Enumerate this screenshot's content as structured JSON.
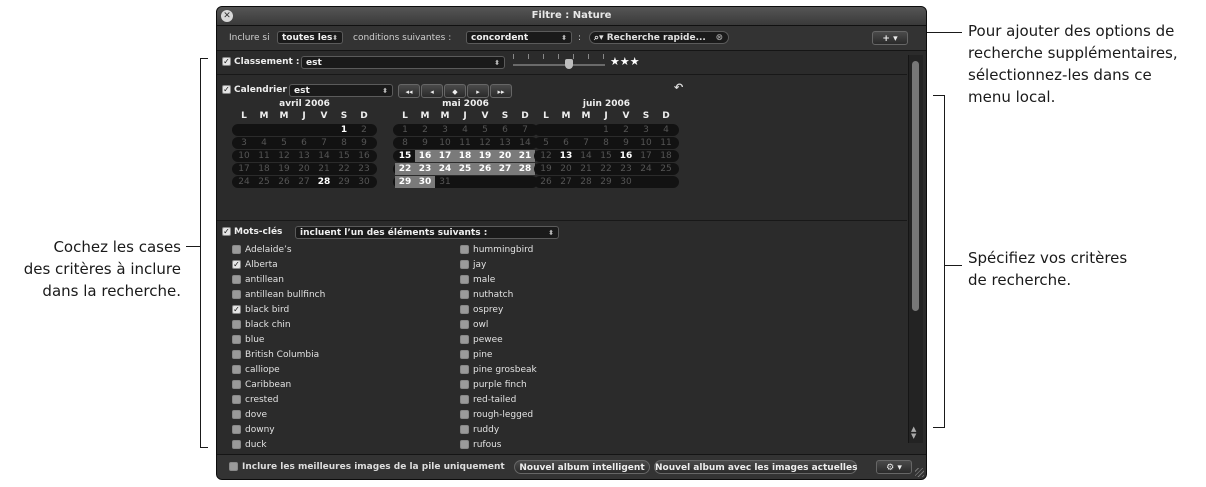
{
  "window": {
    "title": "Filtre : Nature"
  },
  "toolbar": {
    "include_label": "Inclure si",
    "include_value": "toutes les",
    "conditions_label": "conditions suivantes :",
    "match_value": "concordent",
    "colon": ":",
    "search_placeholder": "Recherche rapide...",
    "add_button": "+ ▾"
  },
  "rating": {
    "label": "Classement :",
    "operator": "est",
    "stars": "★★★",
    "checked": true
  },
  "calendar": {
    "label": "Calendrier",
    "operator": "est",
    "checked": true,
    "nav": [
      "◂◂",
      "◂",
      "◆",
      "▸",
      "▸▸"
    ],
    "reset": "↶",
    "weekdays": [
      "L",
      "M",
      "M",
      "J",
      "V",
      "S",
      "D"
    ],
    "months": [
      {
        "title": "avril 2006",
        "weeks": [
          [
            "",
            "",
            "",
            "",
            "",
            "1",
            "2"
          ],
          [
            "3",
            "4",
            "5",
            "6",
            "7",
            "8",
            "9"
          ],
          [
            "10",
            "11",
            "12",
            "13",
            "14",
            "15",
            "16"
          ],
          [
            "17",
            "18",
            "19",
            "20",
            "21",
            "22",
            "23"
          ],
          [
            "24",
            "25",
            "26",
            "27",
            "28",
            "29",
            "30"
          ]
        ],
        "bold": [
          "1",
          "28"
        ],
        "selected": []
      },
      {
        "title": "mai 2006",
        "weeks": [
          [
            "1",
            "2",
            "3",
            "4",
            "5",
            "6",
            "7"
          ],
          [
            "8",
            "9",
            "10",
            "11",
            "12",
            "13",
            "14"
          ],
          [
            "15",
            "16",
            "17",
            "18",
            "19",
            "20",
            "21"
          ],
          [
            "22",
            "23",
            "24",
            "25",
            "26",
            "27",
            "28"
          ],
          [
            "29",
            "30",
            "31",
            "",
            "",
            "",
            ""
          ]
        ],
        "bold": [
          "15"
        ],
        "selected": [
          "16",
          "17",
          "18",
          "19",
          "20",
          "21",
          "22",
          "23",
          "24",
          "25",
          "26",
          "27",
          "28",
          "29",
          "30"
        ]
      },
      {
        "title": "juin 2006",
        "weeks": [
          [
            "",
            "",
            "",
            "1",
            "2",
            "3",
            "4"
          ],
          [
            "5",
            "6",
            "7",
            "8",
            "9",
            "10",
            "11"
          ],
          [
            "12",
            "13",
            "14",
            "15",
            "16",
            "17",
            "18"
          ],
          [
            "19",
            "20",
            "21",
            "22",
            "23",
            "24",
            "25"
          ],
          [
            "26",
            "27",
            "28",
            "29",
            "30",
            "",
            ""
          ]
        ],
        "bold": [
          "13",
          "16"
        ],
        "selected": []
      }
    ]
  },
  "keywords": {
    "label": "Mots-clés",
    "operator": "incluent l’un des éléments suivants :",
    "checked": true,
    "column1": [
      {
        "name": "Adelaide’s",
        "checked": false
      },
      {
        "name": "Alberta",
        "checked": true
      },
      {
        "name": "antillean",
        "checked": false
      },
      {
        "name": "antillean bullfinch",
        "checked": false
      },
      {
        "name": "black bird",
        "checked": true
      },
      {
        "name": "black chin",
        "checked": false
      },
      {
        "name": "blue",
        "checked": false
      },
      {
        "name": "British Columbia",
        "checked": false
      },
      {
        "name": "calliope",
        "checked": false
      },
      {
        "name": "Caribbean",
        "checked": false
      },
      {
        "name": "crested",
        "checked": false
      },
      {
        "name": "dove",
        "checked": false
      },
      {
        "name": "downy",
        "checked": false
      },
      {
        "name": "duck",
        "checked": false
      }
    ],
    "column2": [
      {
        "name": "hummingbird",
        "checked": false
      },
      {
        "name": "jay",
        "checked": false
      },
      {
        "name": "male",
        "checked": false
      },
      {
        "name": "nuthatch",
        "checked": false
      },
      {
        "name": "osprey",
        "checked": false
      },
      {
        "name": "owl",
        "checked": false
      },
      {
        "name": "pewee",
        "checked": false
      },
      {
        "name": "pine",
        "checked": false
      },
      {
        "name": "pine grosbeak",
        "checked": false
      },
      {
        "name": "purple finch",
        "checked": false
      },
      {
        "name": "red-tailed",
        "checked": false
      },
      {
        "name": "rough-legged",
        "checked": false
      },
      {
        "name": "ruddy",
        "checked": false
      },
      {
        "name": "rufous",
        "checked": false
      }
    ]
  },
  "footer": {
    "best_images_label": "Inclure les meilleures images de la pile uniquement",
    "new_smart_album": "Nouvel album intelligent",
    "new_album_current": "Nouvel album avec les images actuelles",
    "gear": "⚙ ▾"
  },
  "callouts": {
    "top_right": [
      "Pour ajouter des options de",
      "recherche supplémentaires,",
      "sélectionnez-les dans ce",
      "menu local."
    ],
    "left": [
      "Cochez les cases",
      "des critères à inclure",
      "dans la recherche."
    ],
    "right": [
      "Spécifiez vos critères",
      "de recherche."
    ]
  }
}
